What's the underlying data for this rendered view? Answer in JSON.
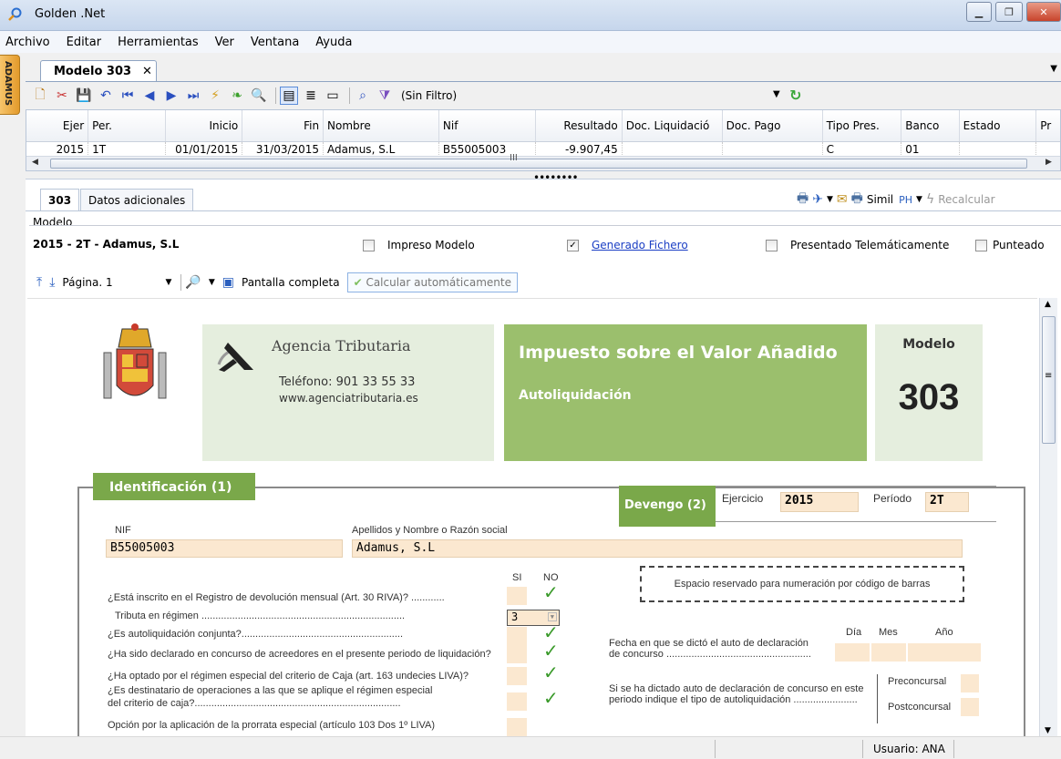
{
  "window": {
    "title": "Golden .Net"
  },
  "menu": [
    "Archivo",
    "Editar",
    "Herramientas",
    "Ver",
    "Ventana",
    "Ayuda"
  ],
  "side_tab": "ADAMUS",
  "doc_tab": {
    "label": "Modelo 303",
    "close": "✕"
  },
  "toolbar": {
    "filter": "(Sin Filtro)"
  },
  "grid": {
    "headers": [
      "Ejer",
      "Per.",
      "Inicio",
      "Fin",
      "Nombre",
      "Nif",
      "Resultado",
      "Doc. Liquidació",
      "Doc. Pago",
      "Tipo Pres.",
      "Banco",
      "Estado",
      "Pr"
    ],
    "rows": [
      [
        "2015",
        "1T",
        "01/01/2015",
        "31/03/2015",
        "Adamus, S.L",
        "B55005003",
        "-9.907,45",
        "",
        "",
        "C",
        "01",
        "",
        ""
      ]
    ]
  },
  "subtabs": {
    "active": "303",
    "other": "Datos adicionales"
  },
  "right_tools": {
    "simil": "Simil",
    "recalc": "Recalcular"
  },
  "modelo": {
    "legend": "Modelo",
    "name": "2015 - 2T - Adamus, S.L",
    "impreso": "Impreso Modelo",
    "generado": "Generado Fichero",
    "presentado": "Presentado Telemáticamente",
    "punteado": "Punteado"
  },
  "viewer": {
    "pagina": "Página. 1",
    "pantalla": "Pantalla completa",
    "calcular": "Calcular automáticamente"
  },
  "form": {
    "agencia": "Agencia Tributaria",
    "telefono": "Teléfono: 901 33 55 33",
    "web": "www.agenciatributaria.es",
    "titulo": "Impuesto sobre el Valor Añadido",
    "subtitulo": "Autoliquidación",
    "modelo_label": "Modelo",
    "modelo_num": "303",
    "identificacion": "Identificación (1)",
    "devengo": "Devengo (2)",
    "ejercicio_label": "Ejercicio",
    "ejercicio": "2015",
    "periodo_label": "Período",
    "periodo": "2T",
    "nif_label": "NIF",
    "nif": "B55005003",
    "nombre_label": "Apellidos y Nombre o Razón social",
    "nombre": "Adamus, S.L",
    "si": "SI",
    "no": "NO",
    "barcode": "Espacio reservado para numeración por código de barras",
    "q1": "¿Está inscrito en el Registro de devolución mensual (Art. 30 RIVA)? ............",
    "q2": "Tributa en régimen .........................................................................",
    "q2_val": "3",
    "q3": "¿Es autoliquidación conjunta?..........................................................",
    "q4": "¿Ha sido declarado en concurso de acreedores en el presente periodo de liquidación?",
    "q5": "¿Ha optado por el régimen especial del criterio de Caja (art. 163 undecies LIVA)?",
    "q6a": "¿Es destinatario de operaciones a las que se aplique el régimen especial",
    "q6b": "del criterio de caja?..........................................................................",
    "q7": "Opción por la aplicación de la prorrata especial (artículo 103 Dos 1º LIVA)",
    "dia": "Día",
    "mes": "Mes",
    "anio": "Año",
    "fecha_a": "Fecha en que se dictó el auto de declaración",
    "fecha_b": "de concurso ....................................................",
    "auto_a": "Si se ha dictado auto de declaración de concurso en este",
    "auto_b": "periodo indique el tipo de autoliquidación .......................",
    "preconcursal": "Preconcursal",
    "postconcursal": "Postconcursal"
  },
  "status": {
    "user": "Usuario: ANA"
  }
}
